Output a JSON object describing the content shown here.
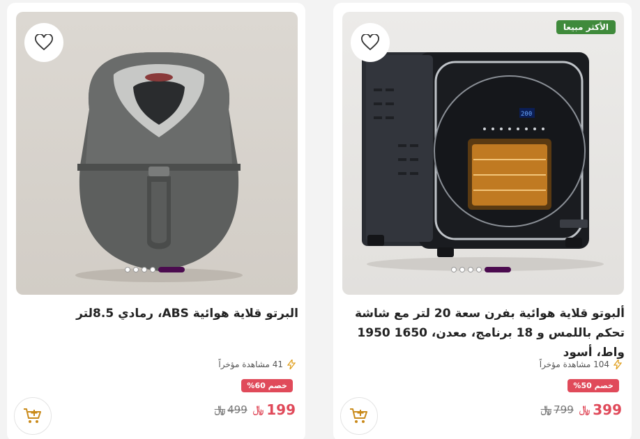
{
  "products": [
    {
      "badge": "الأكثر مبيعا",
      "title": "ألبوتو قلاية هوائية بفرن سعة 20 لتر مع شاشة تحكم باللمس و 18 برنامج، معدن، 1650 1950 واط، أسود",
      "views": "104 مشاهدة مؤخراً",
      "discount": "خصم 50%",
      "price_now": "399",
      "price_old": "799",
      "currency": "﷼",
      "carousel": {
        "slides": 5,
        "active": 5
      }
    },
    {
      "title": "البرتو قلاية هوائية ABS، رمادي 8.5لتر",
      "views": "41 مشاهدة مؤخراً",
      "discount": "خصم 60%",
      "price_now": "199",
      "price_old": "499",
      "currency": "﷼",
      "carousel": {
        "slides": 5,
        "active": 5
      }
    }
  ],
  "colors": {
    "badge": "#3f8a3b",
    "sale": "#e04a5a",
    "carousel_active": "#4b0b4f",
    "cart_icon": "#c98a1a",
    "views_icon": "#e0a020"
  }
}
